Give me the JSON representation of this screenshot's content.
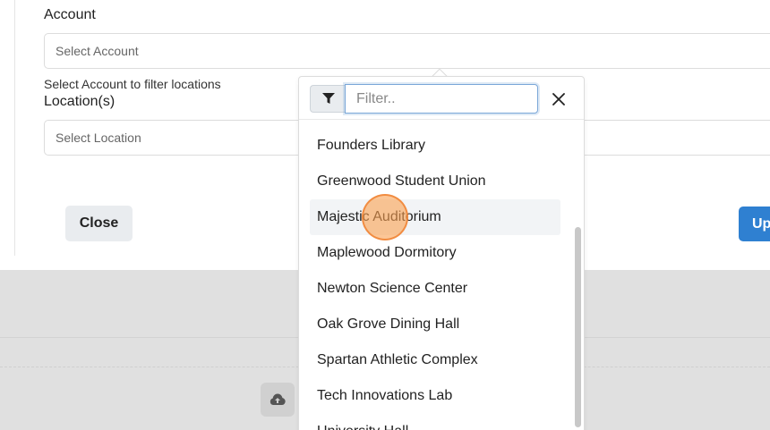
{
  "form": {
    "account_label": "Account",
    "account_placeholder": "Select Account",
    "account_hint": "Select Account to filter locations",
    "location_label": "Location(s)",
    "location_placeholder": "Select Location"
  },
  "actions": {
    "close_label": "Close",
    "update_label": "Up"
  },
  "dropdown": {
    "filter_placeholder": "Filter..",
    "items": [
      "Founders Library",
      "Greenwood Student Union",
      "Majestic Auditorium",
      "Maplewood Dormitory",
      "Newton Science Center",
      "Oak Grove Dining Hall",
      "Spartan Athletic Complex",
      "Tech Innovations Lab",
      "University Hall"
    ],
    "hovered_item": "Majestic Auditorium"
  },
  "icons": {
    "filter": "filter-icon",
    "close": "close-icon",
    "upload": "cloud-upload-icon"
  },
  "colors": {
    "primary": "#2f80d1",
    "focus_border": "#7aa7d8",
    "backdrop": "#e0e0e0"
  }
}
